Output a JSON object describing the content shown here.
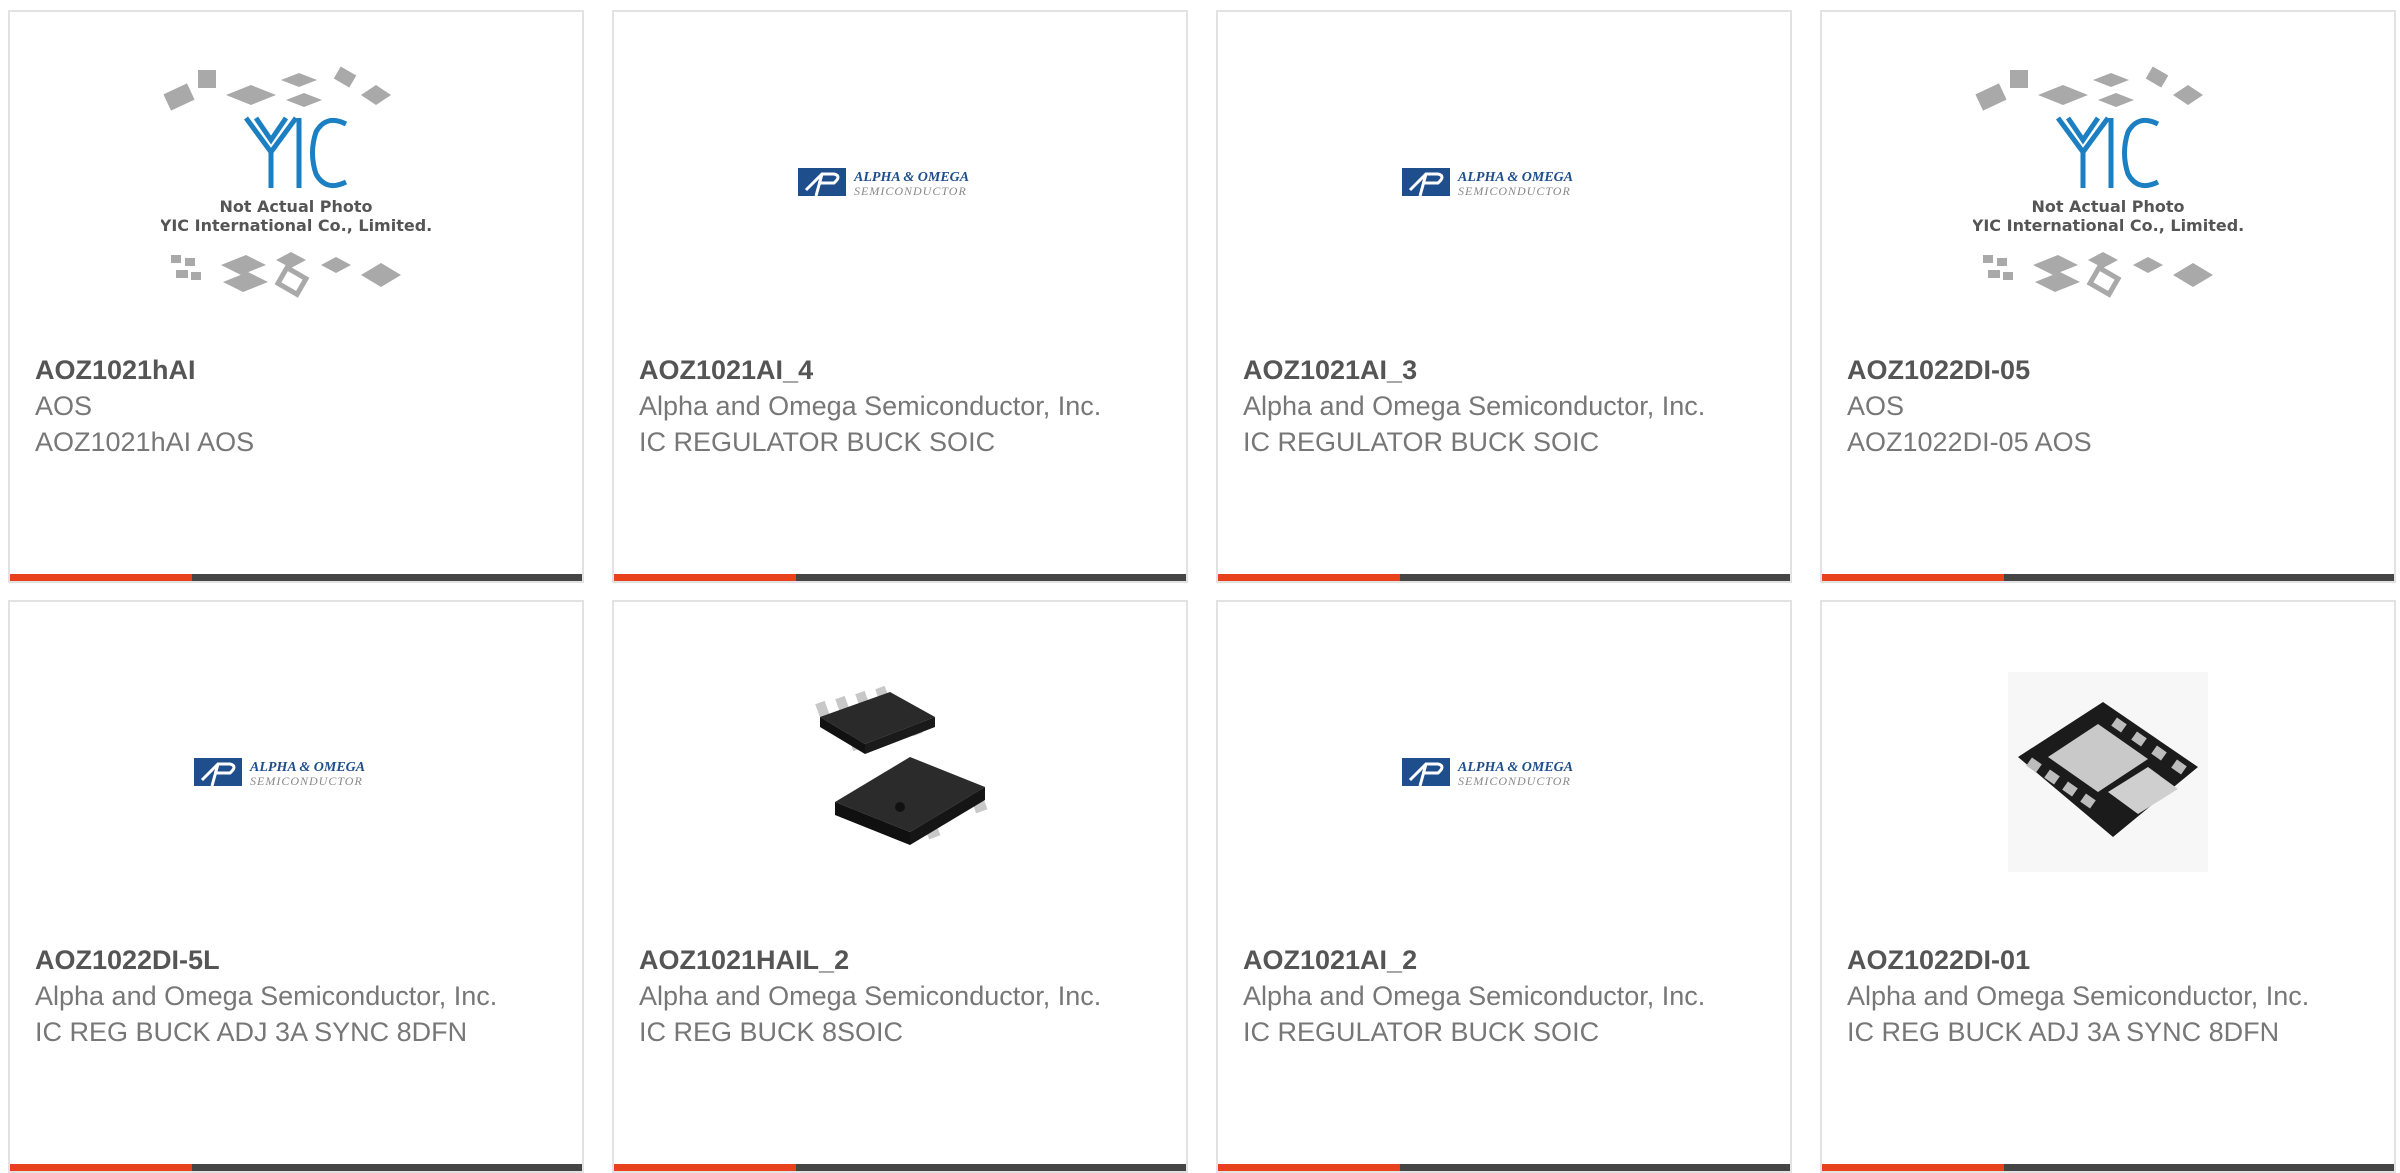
{
  "products": [
    {
      "part": "AOZ1021hAI",
      "manufacturer": "AOS",
      "description": "AOZ1021hAI AOS",
      "image": "yic-placeholder",
      "image_text": [
        "Not Actual Photo",
        "YIC International Co., Limited."
      ]
    },
    {
      "part": "AOZ1021AI_4",
      "manufacturer": "Alpha and Omega Semiconductor, Inc.",
      "description": "IC REGULATOR BUCK SOIC",
      "image": "alpha-omega-logo",
      "image_text": [
        "ALPHA & OMEGA",
        "SEMICONDUCTOR"
      ]
    },
    {
      "part": "AOZ1021AI_3",
      "manufacturer": "Alpha and Omega Semiconductor, Inc.",
      "description": "IC REGULATOR BUCK SOIC",
      "image": "alpha-omega-logo",
      "image_text": [
        "ALPHA & OMEGA",
        "SEMICONDUCTOR"
      ]
    },
    {
      "part": "AOZ1022DI-05",
      "manufacturer": "AOS",
      "description": "AOZ1022DI-05 AOS",
      "image": "yic-placeholder",
      "image_text": [
        "Not Actual Photo",
        "YIC International Co., Limited."
      ]
    },
    {
      "part": "AOZ1022DI-5L",
      "manufacturer": "Alpha and Omega Semiconductor, Inc.",
      "description": "IC REG BUCK ADJ 3A SYNC 8DFN",
      "image": "alpha-omega-logo",
      "image_text": [
        "ALPHA & OMEGA",
        "SEMICONDUCTOR"
      ]
    },
    {
      "part": "AOZ1021HAIL_2",
      "manufacturer": "Alpha and Omega Semiconductor, Inc.",
      "description": "IC REG BUCK 8SOIC",
      "image": "soic8-chip-photo",
      "image_text": []
    },
    {
      "part": "AOZ1021AI_2",
      "manufacturer": "Alpha and Omega Semiconductor, Inc.",
      "description": "IC REGULATOR BUCK SOIC",
      "image": "alpha-omega-logo",
      "image_text": [
        "ALPHA & OMEGA",
        "SEMICONDUCTOR"
      ]
    },
    {
      "part": "AOZ1022DI-01",
      "manufacturer": "Alpha and Omega Semiconductor, Inc.",
      "description": "IC REG BUCK ADJ 3A SYNC 8DFN",
      "image": "dfn8-chip-photo",
      "image_text": []
    }
  ],
  "colors": {
    "accent": "#e8421c",
    "bar": "#454545",
    "border": "#e2e2e2",
    "logo_blue": "#1f4e8c"
  }
}
